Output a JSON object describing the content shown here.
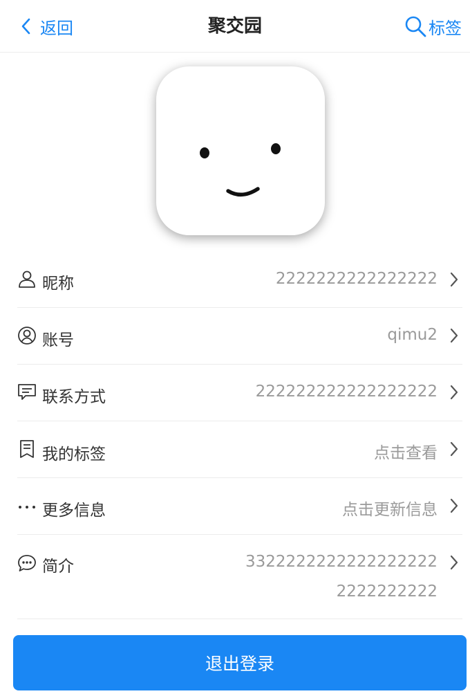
{
  "navbar": {
    "back_label": "返回",
    "title": "聚交园",
    "tag_label": "标签",
    "accent_color": "#1a87f4"
  },
  "avatar": {
    "icon": "smiley-face-avatar"
  },
  "rows": [
    {
      "icon": "user-icon",
      "label": "昵称",
      "value": "2222222222222222"
    },
    {
      "icon": "account-circle-icon",
      "label": "账号",
      "value": "qimu2"
    },
    {
      "icon": "message-icon",
      "label": "联系方式",
      "value": "222222222222222222"
    },
    {
      "icon": "bookmark-icon",
      "label": "我的标签",
      "value": "点击查看"
    },
    {
      "icon": "more-dots-icon",
      "label": "更多信息",
      "value": "点击更新信息"
    },
    {
      "icon": "chat-bubble-icon",
      "label": "简介",
      "value": "3322222222222222222",
      "value_line2": "2222222222"
    }
  ],
  "logout": {
    "label": "退出登录",
    "color": "#1a87f4"
  }
}
